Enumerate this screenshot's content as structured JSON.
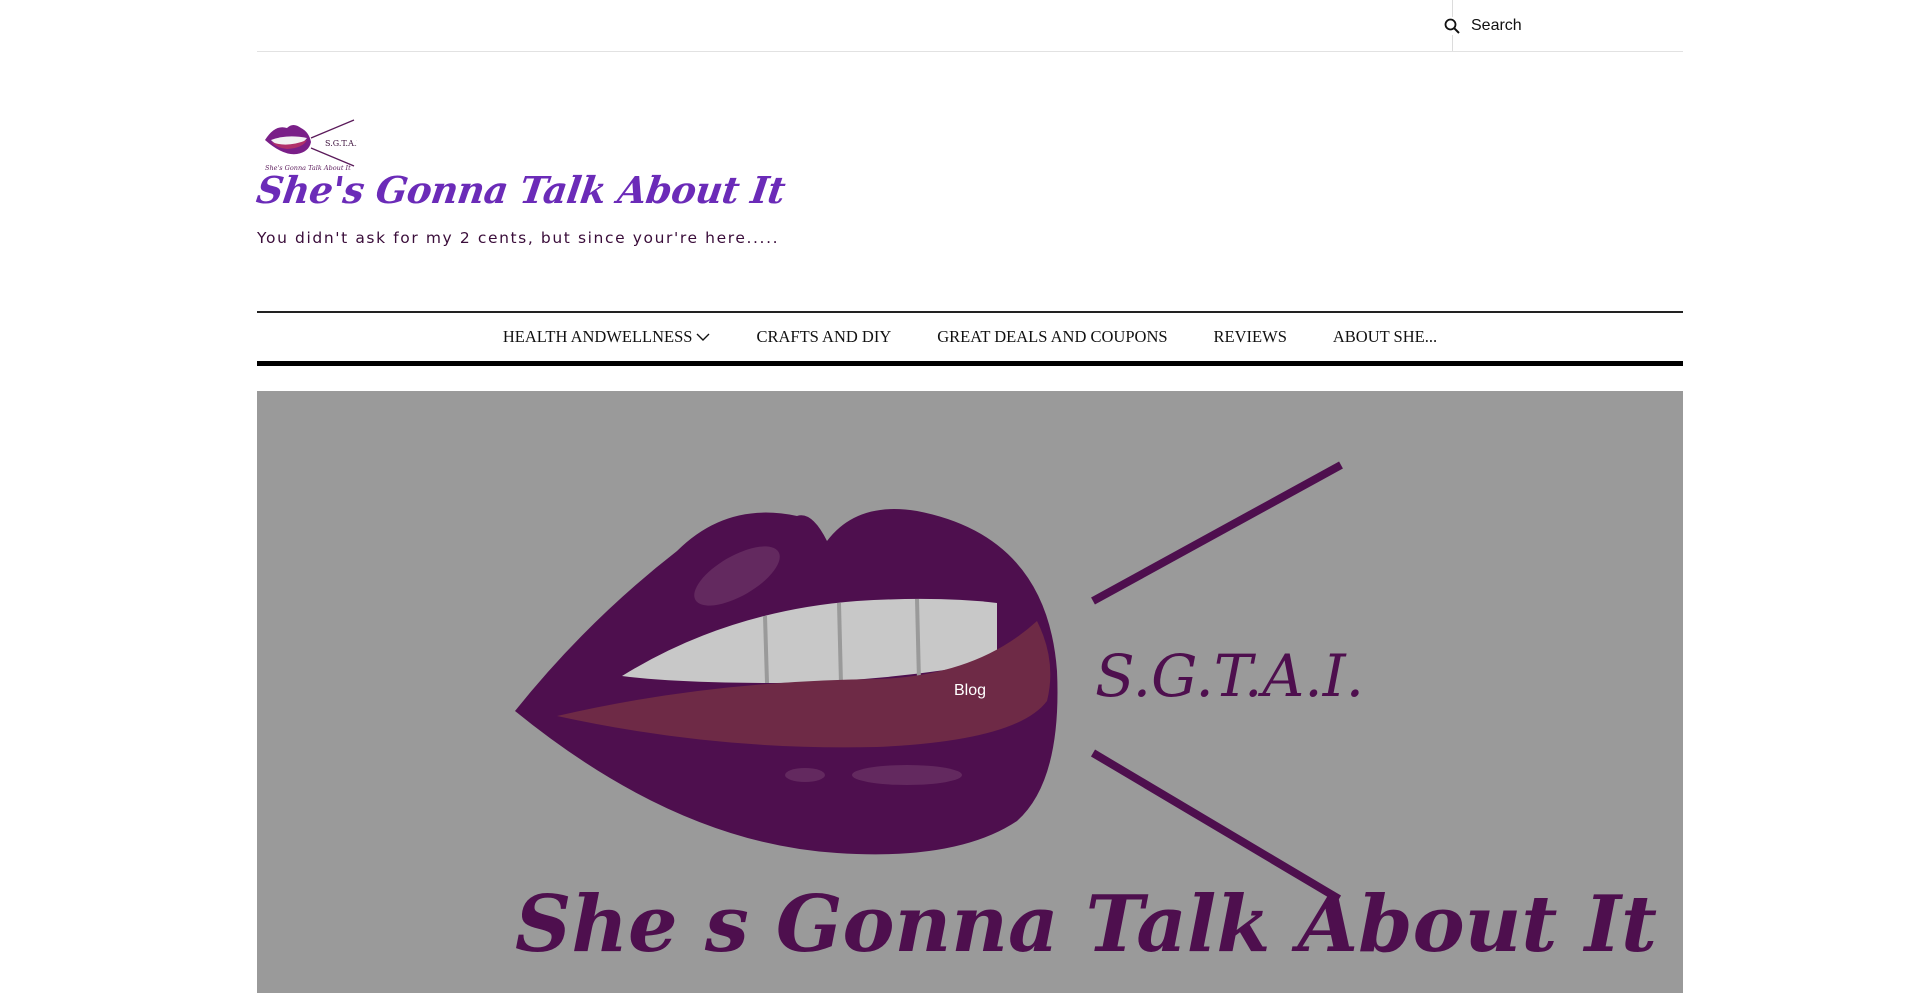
{
  "search": {
    "placeholder": "Search"
  },
  "branding": {
    "logo_text": "S.G.T.A.I.",
    "site_title": "She's Gonna Talk About It",
    "tagline": "You didn't ask for my 2 cents, but since your're here....."
  },
  "nav": {
    "items": [
      {
        "label": "HEALTH ANDWELLNESS",
        "has_submenu": true
      },
      {
        "label": "CRAFTS AND DIY"
      },
      {
        "label": "GREAT DEALS AND COUPONS"
      },
      {
        "label": "REVIEWS"
      },
      {
        "label": "ABOUT SHE..."
      }
    ]
  },
  "hero": {
    "label": "Blog",
    "logo_initials": "S.G.T.A.I.",
    "logo_script": "She s Gonna Talk About It"
  },
  "colors": {
    "title_purple": "#6b2bb8",
    "lip_purple": "#4e0f4e",
    "hero_overlay": "#9a9a9a",
    "nav_border": "#000000"
  }
}
